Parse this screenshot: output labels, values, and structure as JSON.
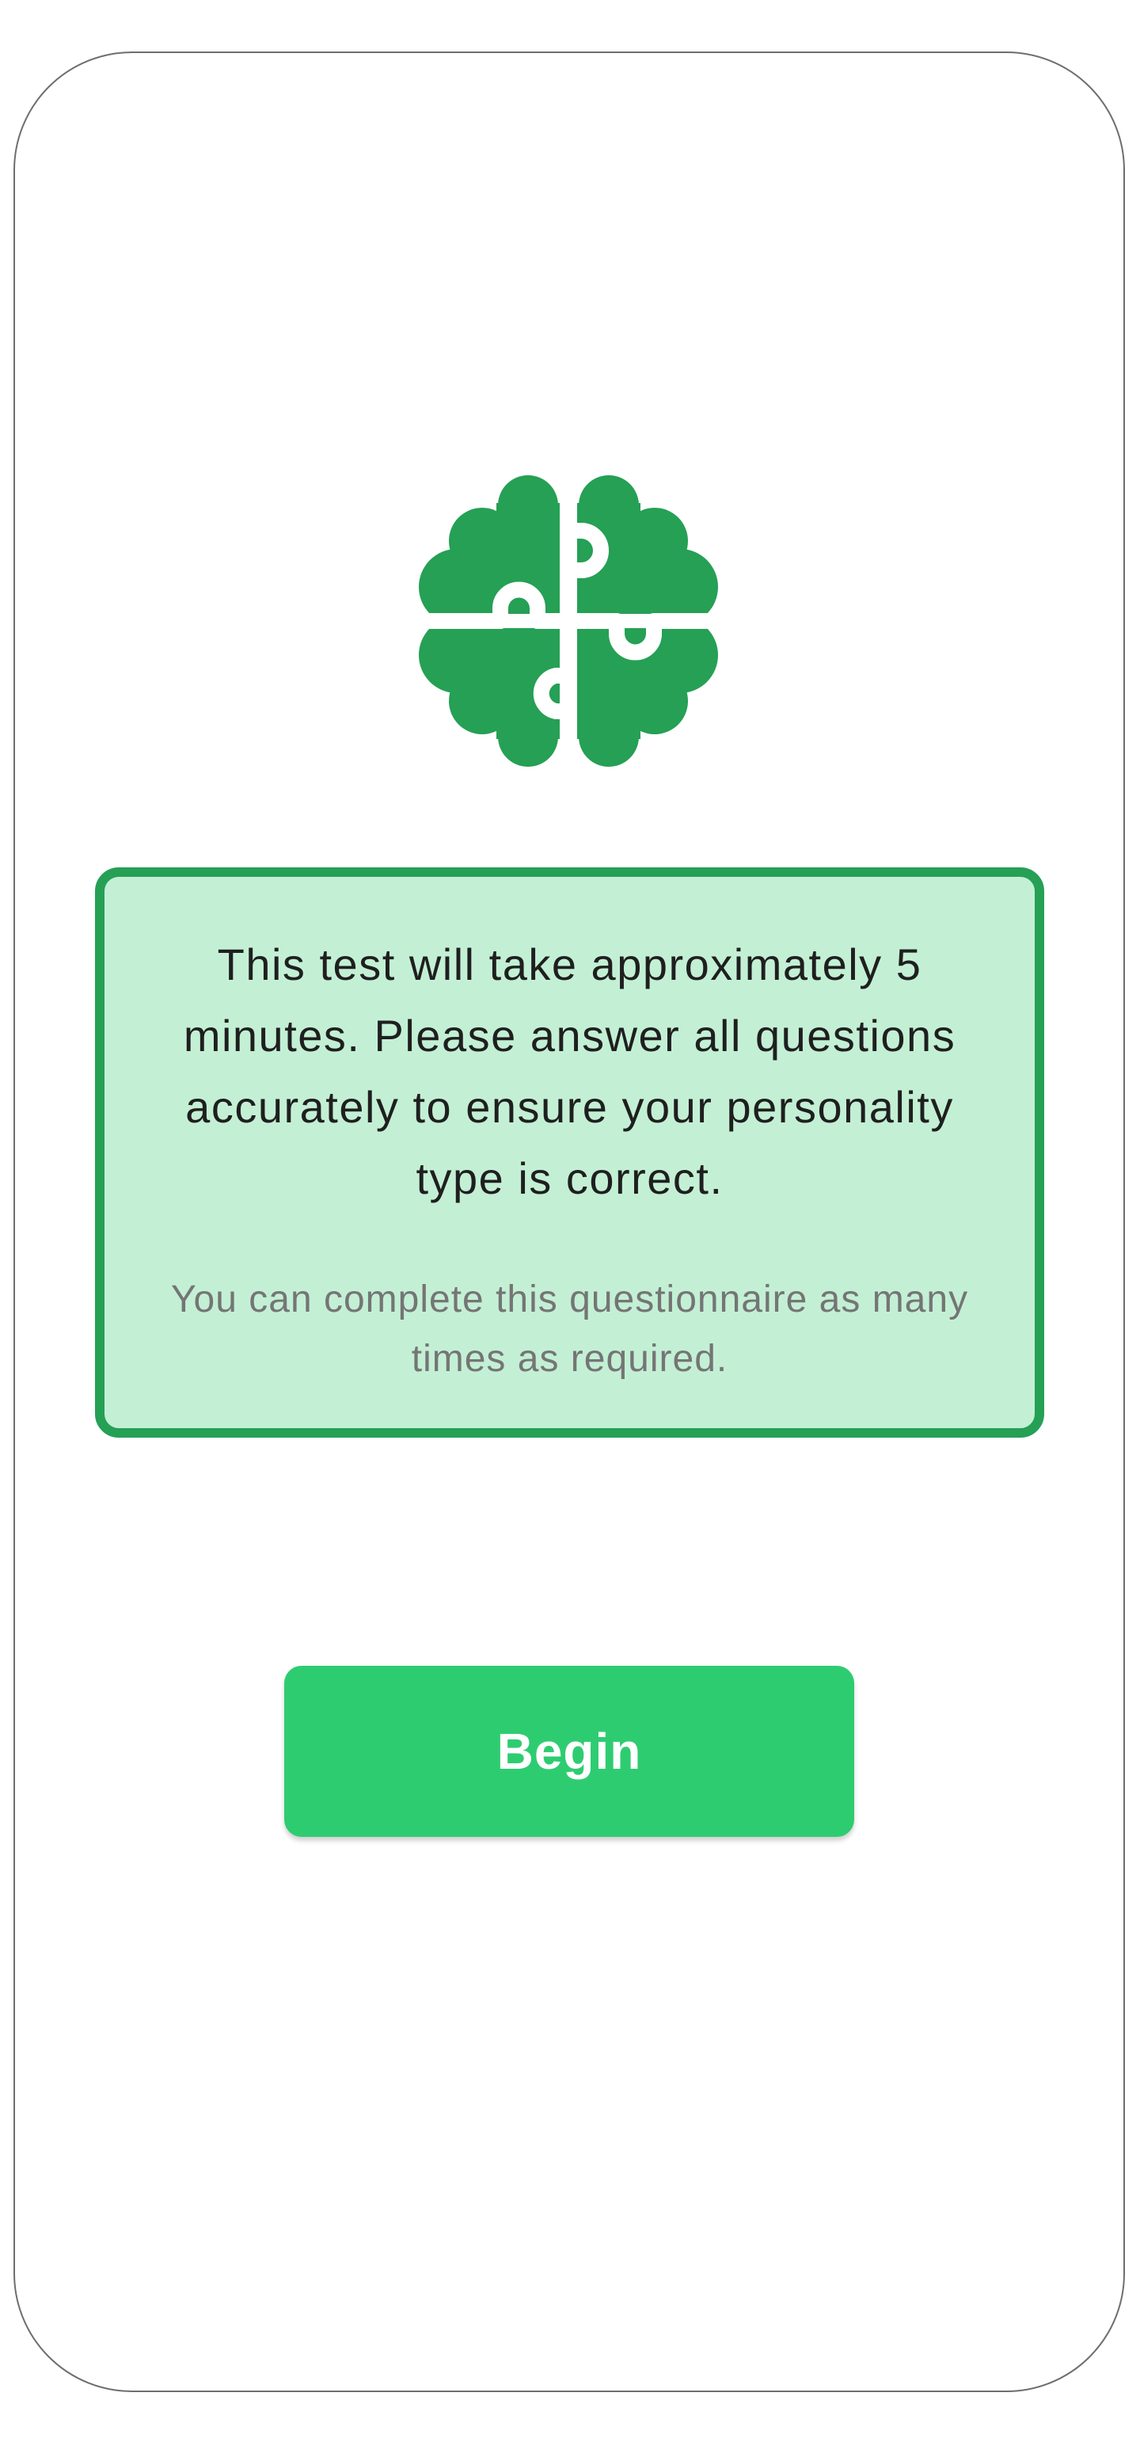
{
  "logo": {
    "icon": "brain-puzzle-icon",
    "color": "#25a055"
  },
  "info_card": {
    "main_text": "This test will take approximately 5 minutes. Please answer all questions accurately to ensure your personality type is correct.",
    "secondary_text": "You can complete this questionnaire as many times as required.",
    "background_color": "#c3f0d5",
    "border_color": "#25a055"
  },
  "begin_button": {
    "label": "Begin",
    "color": "#2ecc71"
  }
}
